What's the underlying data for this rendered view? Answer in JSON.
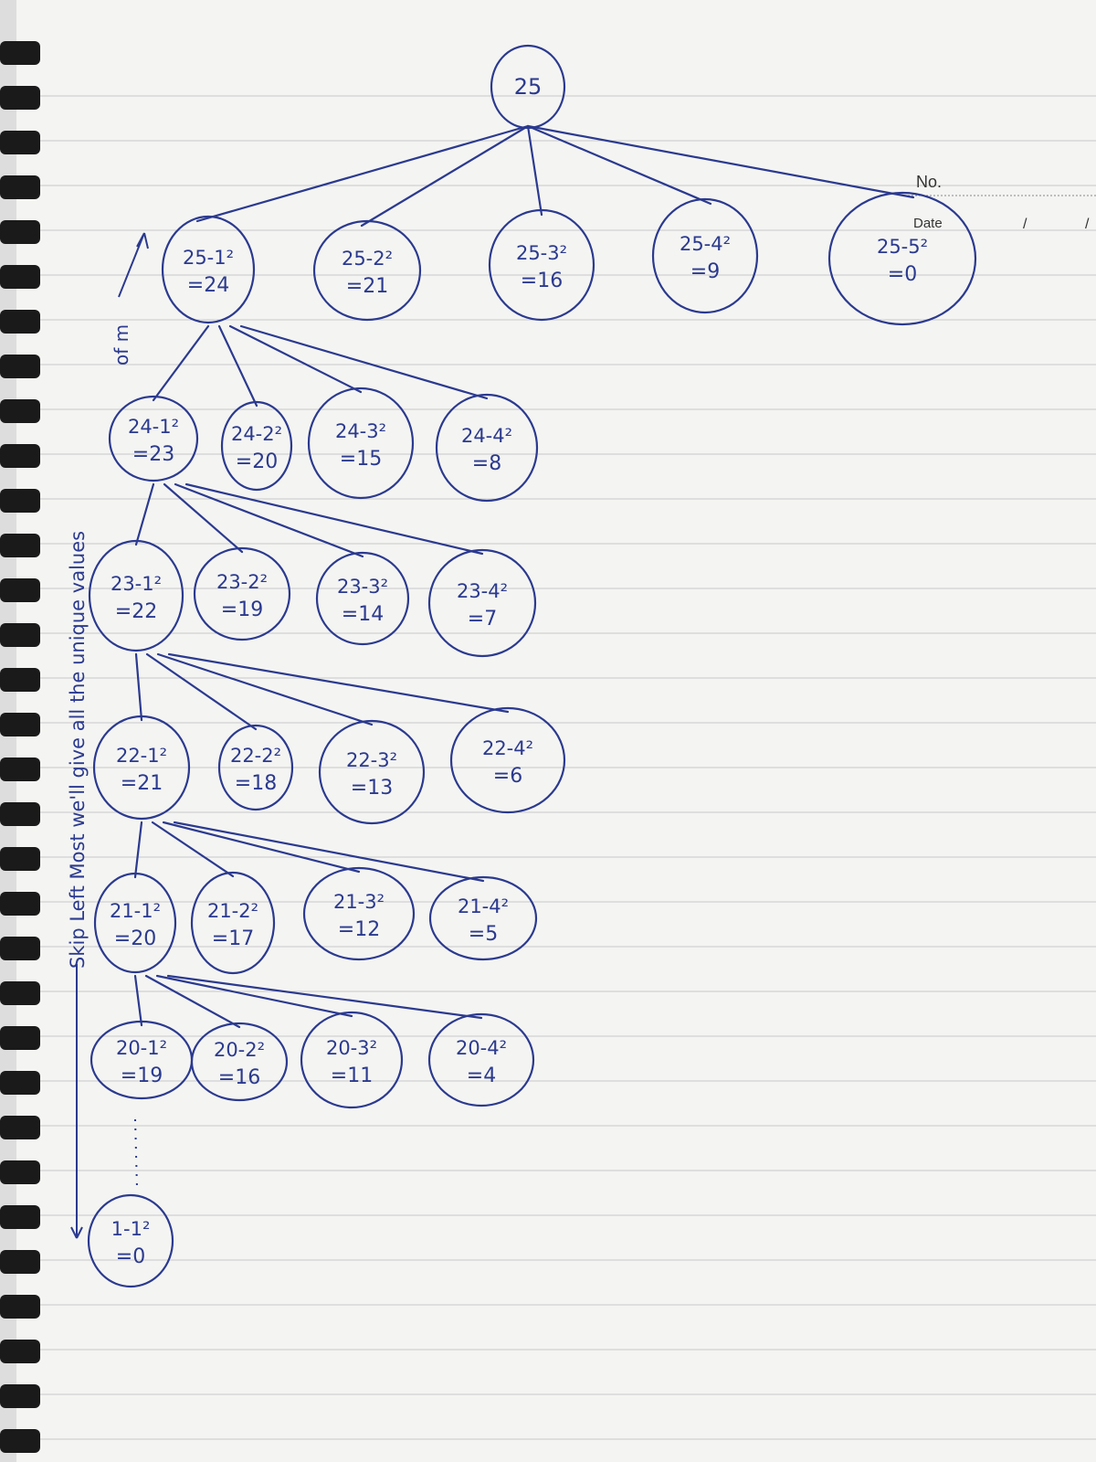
{
  "header": {
    "no_label": "No.",
    "date_label": "Date",
    "date_slashes": [
      "/",
      "/"
    ]
  },
  "colors": {
    "ink": "#2b3a8f",
    "paper": "#f4f4f2",
    "rule": "#c9c9c9",
    "binding": "#1a1a1a"
  },
  "diagram": {
    "root": {
      "text": "25"
    },
    "level1": [
      {
        "expr": "25-1²",
        "result": "=24"
      },
      {
        "expr": "25-2²",
        "result": "=21"
      },
      {
        "expr": "25-3²",
        "result": "=16"
      },
      {
        "expr": "25-4²",
        "result": "=9"
      },
      {
        "expr": "25-5²",
        "result": "=0"
      }
    ],
    "rows": [
      [
        {
          "expr": "24-1²",
          "result": "=23"
        },
        {
          "expr": "24-2²",
          "result": "=20"
        },
        {
          "expr": "24-3²",
          "result": "=15"
        },
        {
          "expr": "24-4²",
          "result": "=8"
        }
      ],
      [
        {
          "expr": "23-1²",
          "result": "=22"
        },
        {
          "expr": "23-2²",
          "result": "=19"
        },
        {
          "expr": "23-3²",
          "result": "=14"
        },
        {
          "expr": "23-4²",
          "result": "=7"
        }
      ],
      [
        {
          "expr": "22-1²",
          "result": "=21"
        },
        {
          "expr": "22-2²",
          "result": "=18"
        },
        {
          "expr": "22-3²",
          "result": "=13"
        },
        {
          "expr": "22-4²",
          "result": "=6"
        }
      ],
      [
        {
          "expr": "21-1²",
          "result": "=20"
        },
        {
          "expr": "21-2²",
          "result": "=17"
        },
        {
          "expr": "21-3²",
          "result": "=12"
        },
        {
          "expr": "21-4²",
          "result": "=5"
        }
      ],
      [
        {
          "expr": "20-1²",
          "result": "=19"
        },
        {
          "expr": "20-2²",
          "result": "=16"
        },
        {
          "expr": "20-3²",
          "result": "=11"
        },
        {
          "expr": "20-4²",
          "result": "=4"
        }
      ]
    ],
    "last": {
      "expr": "1-1²",
      "result": "=0"
    },
    "side_note": "Skip Left Most we'll give all the unique values",
    "side_note_end": "of m"
  }
}
